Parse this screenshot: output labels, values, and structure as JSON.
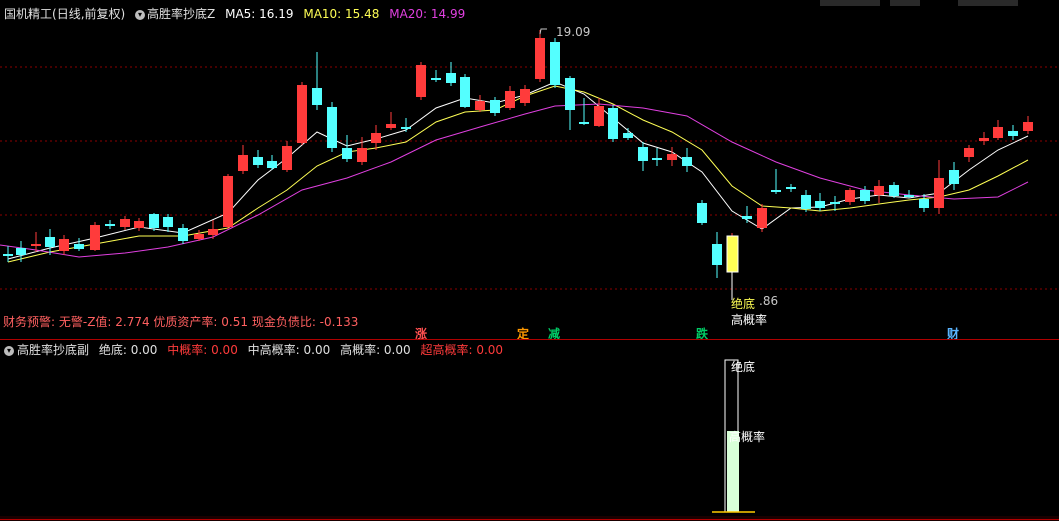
{
  "main": {
    "stock_name": "国机精工",
    "period": "(日线,前复权)",
    "indicator": "高胜率抄底Z",
    "ma5_label": "MA5: 16.19",
    "ma10_label": "MA10: 15.48",
    "ma20_label": "MA20: 14.99",
    "high_price": "19.09",
    "signal_label_1": "绝底",
    "signal_value": ".86",
    "signal_label_2": "高概率",
    "finance_line": "财务预警: 无警-Z值: 2.774 优质资产率: 0.51 现金负债比: -0.133",
    "markers": [
      {
        "text": "涨",
        "color": "#ff5050"
      },
      {
        "text": "定",
        "color": "#ff9900"
      },
      {
        "text": "减",
        "color": "#00cc66"
      },
      {
        "text": "跌",
        "color": "#00cc66"
      },
      {
        "text": "财",
        "color": "#5ab4ff"
      }
    ]
  },
  "sub": {
    "title": "高胜率抄底副",
    "v1": "绝底: 0.00",
    "v2": "中概率: 0.00",
    "v3": "中高概率: 0.00",
    "v4": "高概率: 0.00",
    "v5": "超高概率: 0.00",
    "bar_label_1": "绝底",
    "bar_label_2": "高概率"
  },
  "colors": {
    "up": "#ff3b3b",
    "down": "#54ffff",
    "ma5": "#ffffff",
    "ma10": "#ffff55",
    "ma20": "#e040e0",
    "grid": "#8b0000"
  }
}
